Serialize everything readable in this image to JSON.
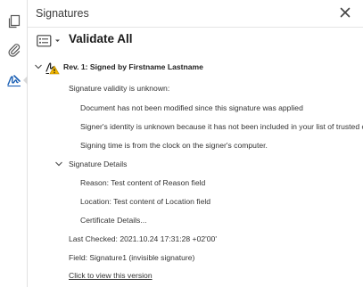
{
  "panel": {
    "title": "Signatures"
  },
  "left_rail": {
    "items": [
      {
        "icon": "pages-icon"
      },
      {
        "icon": "attachment-icon"
      },
      {
        "icon": "signature-icon"
      }
    ]
  },
  "toolbar": {
    "validate_all_label": "Validate All"
  },
  "signature": {
    "revision_label": "Rev. 1: Signed by Firstname Lastname",
    "validity_heading": "Signature validity is unknown:",
    "validity_details": [
      "Document has not been modified since this signature was applied",
      "Signer's identity is unknown because it has not been included in your list of trusted ce",
      "Signing time is from the clock on the signer's computer."
    ],
    "details_label": "Signature Details",
    "details": [
      "Reason: Test content of Reason field",
      "Location: Test content of Location field",
      "Certificate Details..."
    ],
    "last_checked": "Last Checked: 2021.10.24 17:31:28 +02'00'",
    "field": "Field: Signature1 (invisible signature)",
    "view_link": "Click to view this version"
  },
  "colors": {
    "accent_blue": "#1a5fb4",
    "warning_yellow": "#f2b600",
    "border": "#e1e1e1"
  }
}
